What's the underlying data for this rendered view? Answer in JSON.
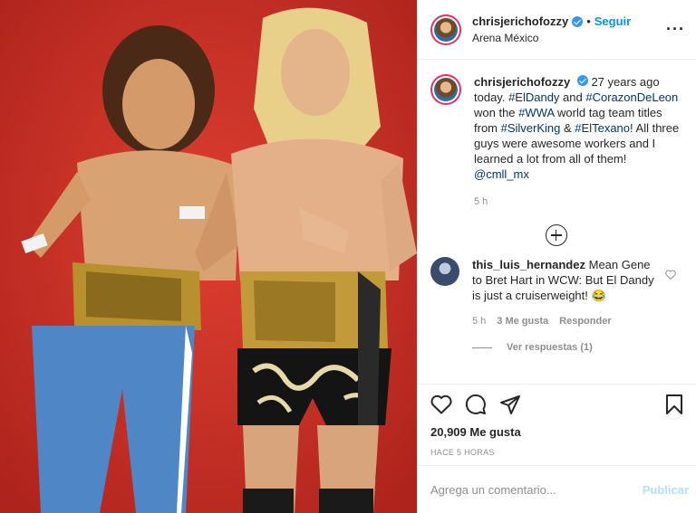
{
  "post": {
    "image_description_icon": "wrestlers-photo",
    "header": {
      "username": "chrisjerichofozzy",
      "follow_label": "Seguir",
      "separator": "•",
      "location": "Arena México",
      "more_icon": "ellipsis-icon"
    },
    "caption": {
      "username": "chrisjerichofozzy",
      "segments": [
        {
          "text": "27 years ago today. ",
          "type": "text"
        },
        {
          "text": "#ElDandy",
          "type": "tag"
        },
        {
          "text": " and ",
          "type": "text"
        },
        {
          "text": "#CorazonDeLeon",
          "type": "tag"
        },
        {
          "text": " won the ",
          "type": "text"
        },
        {
          "text": "#WWA",
          "type": "tag"
        },
        {
          "text": " world tag team titles from ",
          "type": "text"
        },
        {
          "text": "#SilverKing",
          "type": "tag"
        },
        {
          "text": " & ",
          "type": "text"
        },
        {
          "text": "#ElTexano",
          "type": "tag"
        },
        {
          "text": "! All three guys were awesome workers and I learned a lot from all of them! ",
          "type": "text"
        },
        {
          "text": "@cmll_mx",
          "type": "tag"
        }
      ],
      "time": "5 h"
    },
    "comments": [
      {
        "username": "this_luis_hernandez",
        "text": "Mean Gene to Bret Hart in WCW: But El Dandy is just a cruiserweight! 😂",
        "time": "5 h",
        "likes": "3 Me gusta",
        "reply_label": "Responder",
        "view_replies": "Ver respuestas (1)"
      }
    ],
    "likes_count": "20,909 Me gusta",
    "posted_ago": "HACE 5 HORAS",
    "add_comment_placeholder": "Agrega un comentario...",
    "publish_label": "Publicar"
  },
  "colors": {
    "accent": "#0095f6",
    "tag": "#00376b",
    "muted": "#8e8e8e",
    "publish_disabled": "#b2dffc",
    "photo_background": "#d6322a"
  }
}
